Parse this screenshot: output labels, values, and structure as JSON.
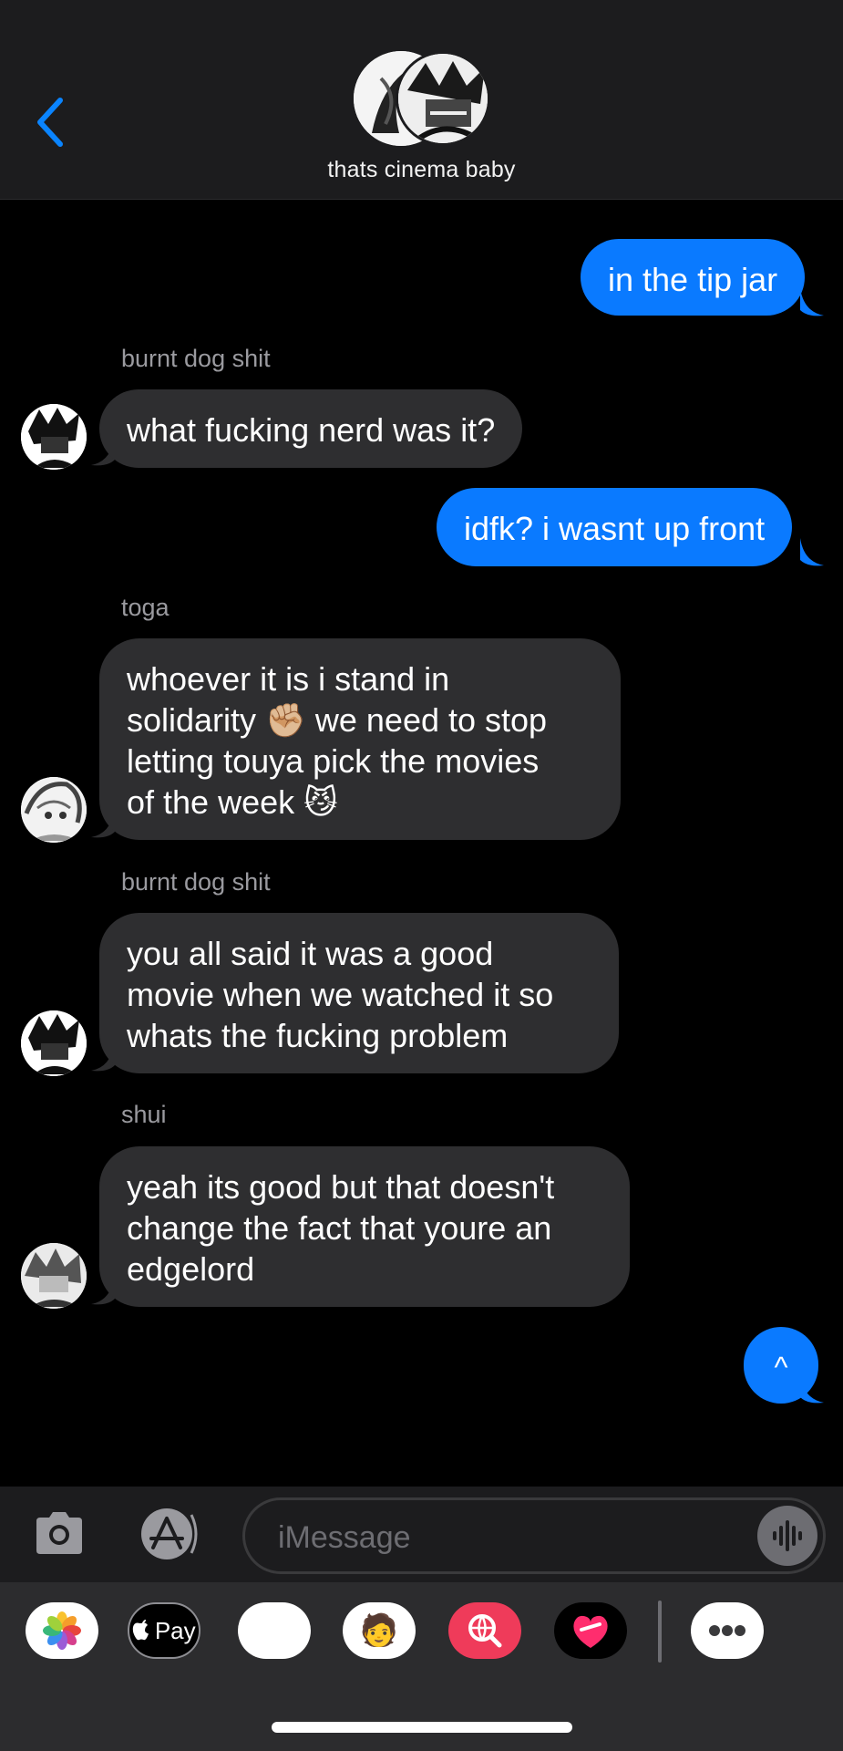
{
  "header": {
    "group_name": "thats cinema baby",
    "back_icon": "chevron-left-icon"
  },
  "messages": [
    {
      "from": "me",
      "text": "in the tip jar"
    },
    {
      "from": "other",
      "sender": "burnt dog shit",
      "text": "what fucking nerd was it?"
    },
    {
      "from": "me",
      "text": "idfk? i wasnt up front"
    },
    {
      "from": "other",
      "sender": "toga",
      "lines": [
        "whoever it is i stand in",
        "solidarity ✊🏼 we need to stop",
        "letting touya pick the movies",
        "of the week 😼"
      ]
    },
    {
      "from": "other",
      "sender": "burnt dog shit",
      "lines": [
        "you all said it was a good",
        "movie when we watched it so",
        "whats the fucking problem"
      ]
    },
    {
      "from": "other",
      "sender": "shui",
      "lines": [
        "yeah its good but that doesn't",
        "change the fact that youre an",
        "edgelord"
      ]
    },
    {
      "from": "me",
      "text": "^"
    }
  ],
  "input": {
    "placeholder": "iMessage",
    "camera_icon": "camera-icon",
    "appstore_icon": "app-store-icon",
    "audio_icon": "audio-waveform-icon"
  },
  "tray": {
    "apps": [
      "photos-icon",
      "apple-pay-icon",
      "animoji-icon",
      "memoji-icon",
      "web-search-icon",
      "digital-touch-icon",
      "more-icon"
    ],
    "apple_pay_label": "Pay"
  },
  "colors": {
    "accent": "#0a7aff",
    "incoming_bubble": "#2e2e30",
    "header_bg": "#1c1c1e",
    "sender_text": "#9a9a9f"
  }
}
